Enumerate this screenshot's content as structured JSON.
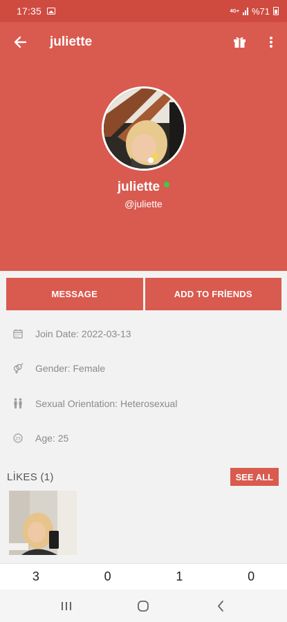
{
  "status_bar": {
    "time": "17:35",
    "network": "4G+",
    "battery": "%71"
  },
  "app_bar": {
    "title": "juliette",
    "back_icon": "arrow-left-icon",
    "gift_icon": "gift-icon",
    "more_icon": "more-vert-icon"
  },
  "profile": {
    "name": "juliette",
    "handle": "@juliette",
    "online": true
  },
  "actions": {
    "message": "MESSAGE",
    "add_friend": "ADD TO FRİENDS"
  },
  "info": [
    {
      "icon": "calendar-icon",
      "text": "Join Date: 2022-03-13"
    },
    {
      "icon": "gender-icon",
      "text": "Gender: Female"
    },
    {
      "icon": "couple-icon",
      "text": "Sexual Orientation: Heterosexual"
    },
    {
      "icon": "age-icon",
      "text": "Age: 25"
    }
  ],
  "likes": {
    "label": "LİKES (1)",
    "see_all": "SEE ALL"
  },
  "stats": [
    "3",
    "0",
    "1",
    "0"
  ],
  "colors": {
    "primary": "#d95a4f",
    "status_bar": "#cf4b40",
    "online": "#3ec94a"
  }
}
